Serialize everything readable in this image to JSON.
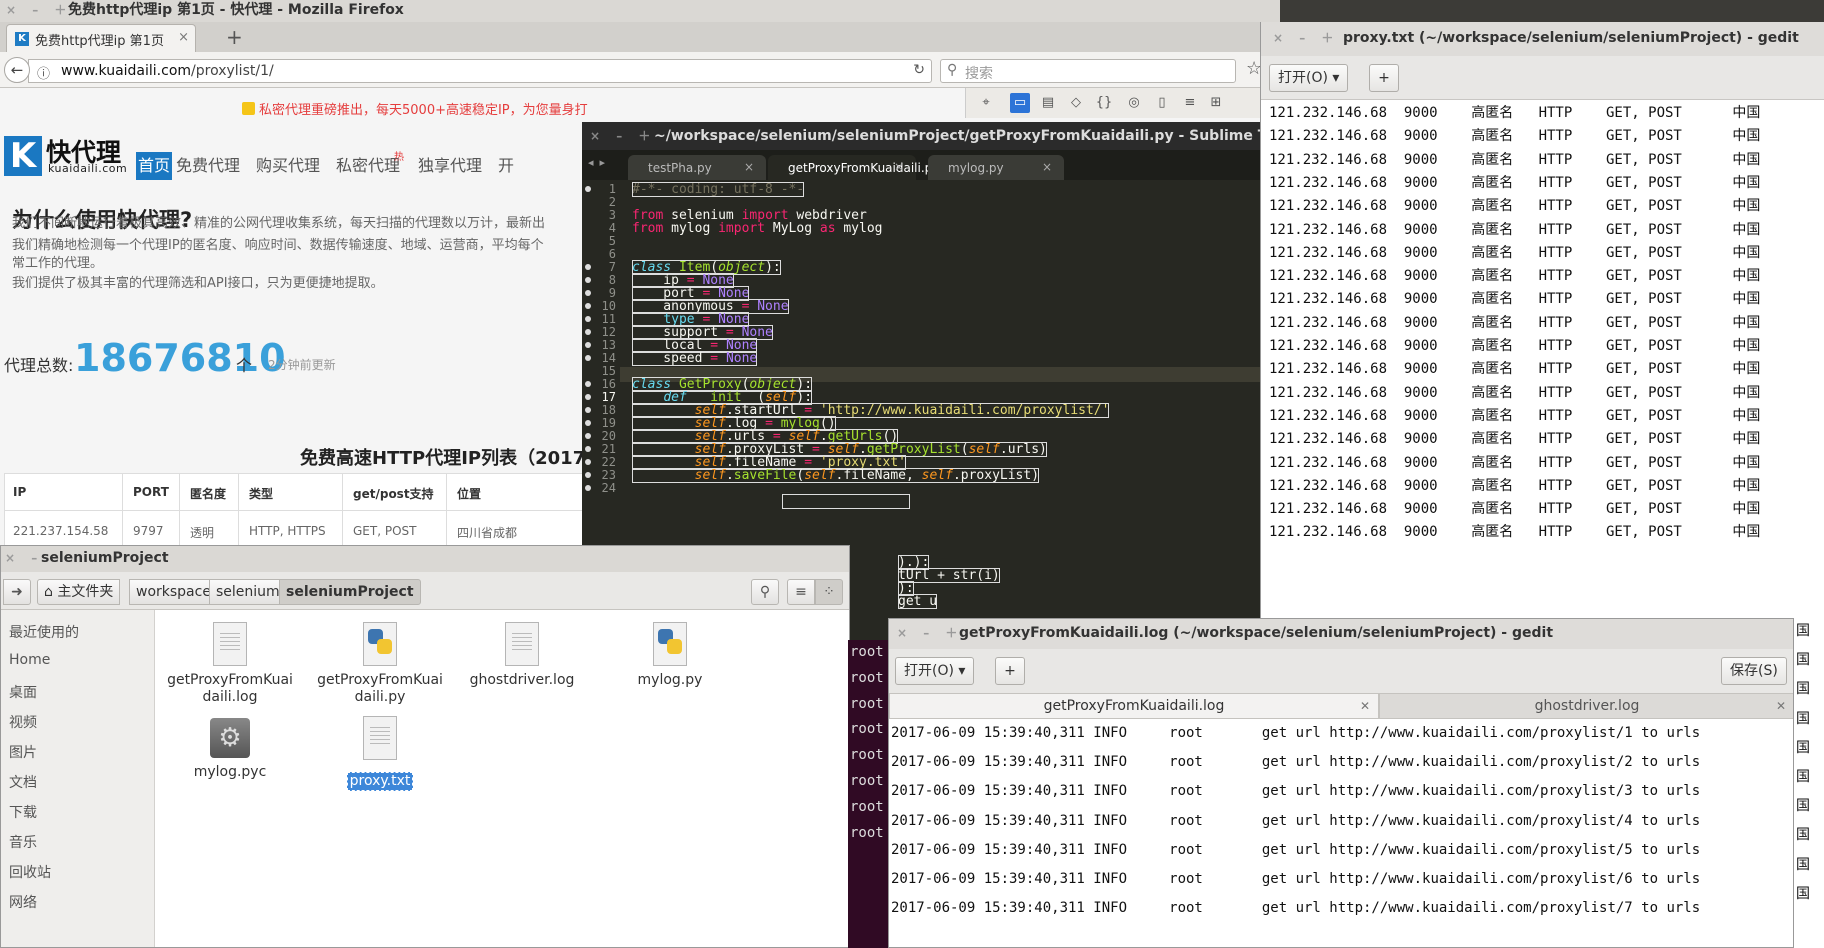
{
  "firefox": {
    "window_title": "免费http代理ip 第1页 - 快代理 - Mozilla Firefox",
    "tab_title": "免费http代理ip 第1页",
    "tab_favicon": "K",
    "url_host": "www.kuaidaili.com",
    "url_path": "/proxylist/1/",
    "search_placeholder": "搜索"
  },
  "site": {
    "promo": "私密代理重磅推出，每天5000+高速稳定IP，为您量身打",
    "logo_letter": "K",
    "logo_title": "快代理",
    "logo_domain": "kuaidaili.com",
    "nav": [
      "首页",
      "免费代理",
      "购买代理",
      "私密代理",
      "独享代理",
      "开"
    ],
    "nav_badge": "热",
    "heading": "为什么使用快代理?",
    "paragraphs": [
      "我们不间断地运行着极其高效、精准的公网代理收集系统，每天扫描的代理数以万计，最新出",
      "我们精确地检测每一个代理IP的匿名度、响应时间、数据传输速度、地域、运营商，平均每个",
      "常工作的代理。",
      "我们提供了极其丰富的代理筛选和API接口，只为更便捷地提取。"
    ],
    "total_label": "代理总数:",
    "total_value": "18676810",
    "total_unit": "个",
    "updated": "2分钟前更新",
    "table_title": "免费高速HTTP代理IP列表（2017-",
    "table_headers": [
      "IP",
      "PORT",
      "匿名度",
      "类型",
      "get/post支持",
      "位置"
    ],
    "table_row": [
      "221.237.154.58",
      "9797",
      "透明",
      "HTTP, HTTPS",
      "GET, POST",
      "四川省成都"
    ]
  },
  "sublime": {
    "title": "~/workspace/selenium/seleniumProject/getProxyFromKuaidaili.py - Sublime Text (UN",
    "tabs": [
      "testPha.py",
      "getProxyFromKuaidaili.py",
      "mylog.py"
    ],
    "line_numbers": [
      "1",
      "2",
      "3",
      "4",
      "5",
      "6",
      "7",
      "8",
      "9",
      "10",
      "11",
      "12",
      "13",
      "14",
      "15",
      "16",
      "17",
      "18",
      "19",
      "20",
      "21",
      "22",
      "23",
      "24"
    ],
    "partial": [
      ").):",
      "tUrl + str(i)",
      "):",
      "get u"
    ]
  },
  "proxy_gedit": {
    "title": "proxy.txt (~/workspace/selenium/seleniumProject) - gedit",
    "open_label": "打开(O)",
    "add_label": "+",
    "rows": [
      "121.232.146.68  9000    高匿名   HTTP    GET, POST      中国",
      "121.232.146.68  9000    高匿名   HTTP    GET, POST      中国",
      "121.232.146.68  9000    高匿名   HTTP    GET, POST      中国",
      "121.232.146.68  9000    高匿名   HTTP    GET, POST      中国",
      "121.232.146.68  9000    高匿名   HTTP    GET, POST      中国",
      "121.232.146.68  9000    高匿名   HTTP    GET, POST      中国",
      "121.232.146.68  9000    高匿名   HTTP    GET, POST      中国",
      "121.232.146.68  9000    高匿名   HTTP    GET, POST      中国",
      "121.232.146.68  9000    高匿名   HTTP    GET, POST      中国",
      "121.232.146.68  9000    高匿名   HTTP    GET, POST      中国",
      "121.232.146.68  9000    高匿名   HTTP    GET, POST      中国",
      "121.232.146.68  9000    高匿名   HTTP    GET, POST      中国",
      "121.232.146.68  9000    高匿名   HTTP    GET, POST      中国",
      "121.232.146.68  9000    高匿名   HTTP    GET, POST      中国",
      "121.232.146.68  9000    高匿名   HTTP    GET, POST      中国",
      "121.232.146.68  9000    高匿名   HTTP    GET, POST      中国",
      "121.232.146.68  9000    高匿名   HTTP    GET, POST      中国",
      "121.232.146.68  9000    高匿名   HTTP    GET, POST      中国",
      "121.232.146.68  9000    高匿名   HTTP    GET, POST      中国"
    ]
  },
  "nautilus": {
    "title": "seleniumProject",
    "crumbs": [
      "主文件夹",
      "workspace",
      "selenium",
      "seleniumProject"
    ],
    "sidebar": [
      "最近使用的",
      "Home",
      "桌面",
      "视频",
      "图片",
      "文档",
      "下载",
      "音乐",
      "回收站",
      "网络"
    ],
    "files": [
      "getProxyFromKuaidaili.log",
      "getProxyFromKuaidaili.py",
      "ghostdriver.log",
      "mylog.py",
      "mylog.pyc",
      "proxy.txt"
    ],
    "files_wrapped": [
      [
        "getProxyFromKuai",
        "daili.log"
      ],
      [
        "getProxyFromKuai",
        "daili.py"
      ],
      [
        "ghostdriver.log"
      ],
      [
        "mylog.py"
      ],
      [
        "mylog.pyc"
      ],
      [
        "proxy.txt"
      ]
    ]
  },
  "terminal": {
    "lines": [
      "root",
      "root",
      "root",
      "root",
      "root",
      "root",
      "root",
      "root"
    ]
  },
  "log_gedit": {
    "title": "getProxyFromKuaidaili.log (~/workspace/selenium/seleniumProject) - gedit",
    "open_label": "打开(O)",
    "add_label": "+",
    "save_label": "保存(S)",
    "tabs": [
      "getProxyFromKuaidaili.log",
      "ghostdriver.log"
    ],
    "lines": [
      "2017-06-09 15:39:40,311 INFO     root       get url http://www.kuaidaili.com/proxylist/1 to urls",
      "2017-06-09 15:39:40,311 INFO     root       get url http://www.kuaidaili.com/proxylist/2 to urls",
      "2017-06-09 15:39:40,311 INFO     root       get url http://www.kuaidaili.com/proxylist/3 to urls",
      "2017-06-09 15:39:40,311 INFO     root       get url http://www.kuaidaili.com/proxylist/4 to urls",
      "2017-06-09 15:39:40,311 INFO     root       get url http://www.kuaidaili.com/proxylist/5 to urls",
      "2017-06-09 15:39:40,311 INFO     root       get url http://www.kuaidaili.com/proxylist/6 to urls",
      "2017-06-09 15:39:40,311 INFO     root       get url http://www.kuaidaili.com/proxylist/7 to urls"
    ]
  },
  "edge_glyphs": [
    "国",
    "国",
    "国",
    "国",
    "国",
    "国",
    "国",
    "国",
    "国",
    "国"
  ]
}
